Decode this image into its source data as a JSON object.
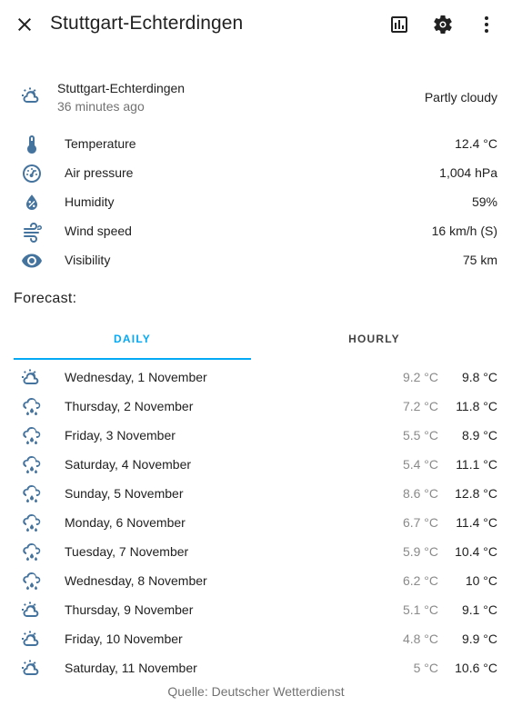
{
  "header": {
    "title": "Stuttgart-Echterdingen",
    "icons": [
      "close-icon",
      "chart-icon",
      "settings-icon",
      "more-vert-icon"
    ]
  },
  "current": {
    "station": "Stuttgart-Echterdingen",
    "updated": "36 minutes ago",
    "state": "Partly cloudy",
    "icon": "partly-cloudy-icon"
  },
  "attributes": [
    {
      "label": "Temperature",
      "value": "12.4 °C",
      "icon": "thermometer-icon"
    },
    {
      "label": "Air pressure",
      "value": "1,004 hPa",
      "icon": "gauge-icon"
    },
    {
      "label": "Humidity",
      "value": "59%",
      "icon": "water-percent-icon"
    },
    {
      "label": "Wind speed",
      "value": "16 km/h (S)",
      "icon": "wind-icon"
    },
    {
      "label": "Visibility",
      "value": "75 km",
      "icon": "eye-icon"
    }
  ],
  "forecast": {
    "title": "Forecast:",
    "tabs": {
      "daily": "DAILY",
      "hourly": "HOURLY",
      "active": "daily"
    },
    "days": [
      {
        "date": "Wednesday, 1 November",
        "low": "9.2 °C",
        "high": "9.8 °C",
        "icon": "partly-cloudy-icon"
      },
      {
        "date": "Thursday, 2 November",
        "low": "7.2 °C",
        "high": "11.8 °C",
        "icon": "rainy-icon"
      },
      {
        "date": "Friday, 3 November",
        "low": "5.5 °C",
        "high": "8.9 °C",
        "icon": "rainy-icon"
      },
      {
        "date": "Saturday, 4 November",
        "low": "5.4 °C",
        "high": "11.1 °C",
        "icon": "rainy-icon"
      },
      {
        "date": "Sunday, 5 November",
        "low": "8.6 °C",
        "high": "12.8 °C",
        "icon": "rainy-icon"
      },
      {
        "date": "Monday, 6 November",
        "low": "6.7 °C",
        "high": "11.4 °C",
        "icon": "rainy-icon"
      },
      {
        "date": "Tuesday, 7 November",
        "low": "5.9 °C",
        "high": "10.4 °C",
        "icon": "rainy-icon"
      },
      {
        "date": "Wednesday, 8 November",
        "low": "6.2 °C",
        "high": "10 °C",
        "icon": "rainy-icon"
      },
      {
        "date": "Thursday, 9 November",
        "low": "5.1 °C",
        "high": "9.1 °C",
        "icon": "partly-cloudy-icon"
      },
      {
        "date": "Friday, 10 November",
        "low": "4.8 °C",
        "high": "9.9 °C",
        "icon": "partly-cloudy-icon"
      },
      {
        "date": "Saturday, 11 November",
        "low": "5 °C",
        "high": "10.6 °C",
        "icon": "partly-cloudy-icon"
      }
    ]
  },
  "attribution": "Quelle: Deutscher Wetterdienst",
  "colors": {
    "accent": "#03a9f4",
    "icon": "#44739e",
    "secondary_text": "#727272"
  }
}
